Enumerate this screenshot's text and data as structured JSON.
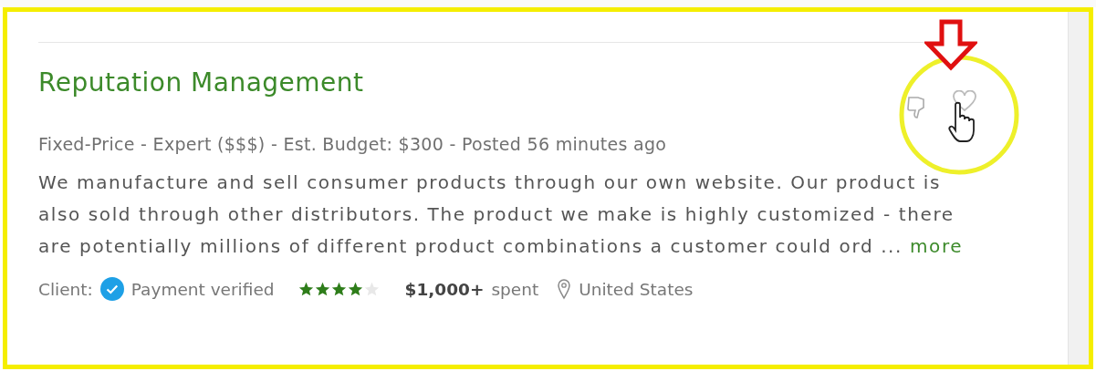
{
  "job": {
    "title": "Reputation Management",
    "meta": "Fixed-Price - Expert ($$$) - Est. Budget: $300 - Posted 56 minutes ago",
    "description": "We manufacture and sell consumer products through our own website. Our product is also sold through other distributors. The product we make is highly customized - there are potentially millions of different product combinations a customer could ord ...",
    "more_link": "more",
    "client": {
      "label": "Client:",
      "payment": "Payment verified",
      "stars": 4,
      "spent_amount": "$1,000+",
      "spent_label": "spent",
      "location": "United States"
    }
  }
}
